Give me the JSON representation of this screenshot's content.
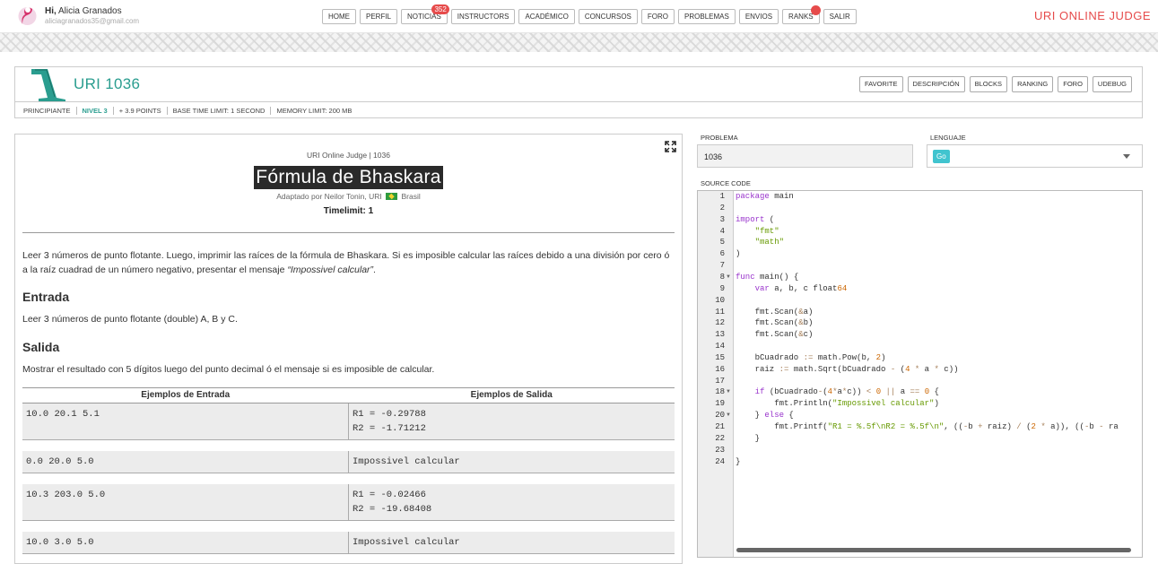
{
  "user": {
    "greeting": "Hi,",
    "name": "Alicia Granados",
    "email": "aliciagranados35@gmail.com"
  },
  "nav": [
    {
      "label": "HOME"
    },
    {
      "label": "PERFIL"
    },
    {
      "label": "NOTICIAS",
      "badge": "352"
    },
    {
      "label": "INSTRUCTORS"
    },
    {
      "label": "ACADÉMICO"
    },
    {
      "label": "CONCURSOS"
    },
    {
      "label": "FORO"
    },
    {
      "label": "PROBLEMAS"
    },
    {
      "label": "ENVIOS"
    },
    {
      "label": "RANKS",
      "dot": true
    },
    {
      "label": "SALIR"
    }
  ],
  "brand": "URI ONLINE JUDGE",
  "problem": {
    "code": "URI 1036",
    "buttons": [
      "FAVORITE",
      "DESCRIPCIÓN",
      "BLOCKS",
      "RANKING",
      "FORO",
      "UDEBUG"
    ],
    "meta": {
      "category": "PRINCIPIANTE",
      "level": "NIVEL 3",
      "points": "+ 3.9 POINTS",
      "time_limit": "BASE TIME LIMIT: 1 SECOND",
      "memory": "MEMORY LIMIT: 200 MB"
    }
  },
  "description": {
    "source": "URI Online Judge | 1036",
    "title": "Fórmula de Bhaskara",
    "adapted_by": "Adaptado por Neilor Tonin, URI",
    "country": "Brasil",
    "timelimit": "Timelimit: 1",
    "statement": "Leer 3 números de punto flotante. Luego, imprimir las raíces de la fórmula de Bhaskara. Si es imposible calcular las raíces debido a una división por cero ó a la raíz cuadrad de un número negativo, presentar el mensaje ",
    "statement_italic": "“Impossivel calcular”",
    "statement_end": ".",
    "input_heading": "Entrada",
    "input_text": "Leer 3 números de punto flotante (double) A, B y C.",
    "output_heading": "Salida",
    "output_text": "Mostrar el resultado con 5 dígitos luego del punto decimal ó el mensaje si es imposible de calcular.",
    "examples_in_header": "Ejemplos de Entrada",
    "examples_out_header": "Ejemplos de Salida",
    "examples": [
      {
        "input": "10.0 20.1 5.1",
        "output": "R1 = -0.29788\nR2 = -1.71212"
      },
      {
        "input": "0.0 20.0 5.0",
        "output": "Impossivel calcular"
      },
      {
        "input": "10.3 203.0 5.0",
        "output": "R1 = -0.02466\nR2 = -19.68408"
      },
      {
        "input": "10.0 3.0 5.0",
        "output": "Impossivel calcular"
      }
    ]
  },
  "form": {
    "problem_label": "PROBLEMA",
    "problem_value": "1036",
    "language_label": "LENGUAJE",
    "language_value": "Go",
    "source_label": "SOURCE CODE"
  },
  "code_lines": [
    "package main",
    "",
    "import (",
    "    \"fmt\"",
    "    \"math\"",
    ")",
    "",
    "func main() {",
    "    var a, b, c float64",
    "",
    "    fmt.Scan(&a)",
    "    fmt.Scan(&b)",
    "    fmt.Scan(&c)",
    "",
    "    bCuadrado := math.Pow(b, 2)",
    "    raiz := math.Sqrt(bCuadrado - (4 * a * c))",
    "",
    "    if (bCuadrado-(4*a*c)) < 0 || a == 0 {",
    "        fmt.Println(\"Impossivel calcular\")",
    "    } else {",
    "        fmt.Printf(\"R1 = %.5f\\nR2 = %.5f\\n\", ((-b + raiz) / (2 * a)), ((-b - ra",
    "    }",
    "",
    "}"
  ],
  "fold_lines": [
    8,
    18,
    20
  ],
  "colors": {
    "accent": "#2a9d8f",
    "brand": "#e64b4b",
    "lang_tag": "#41c4cf"
  }
}
